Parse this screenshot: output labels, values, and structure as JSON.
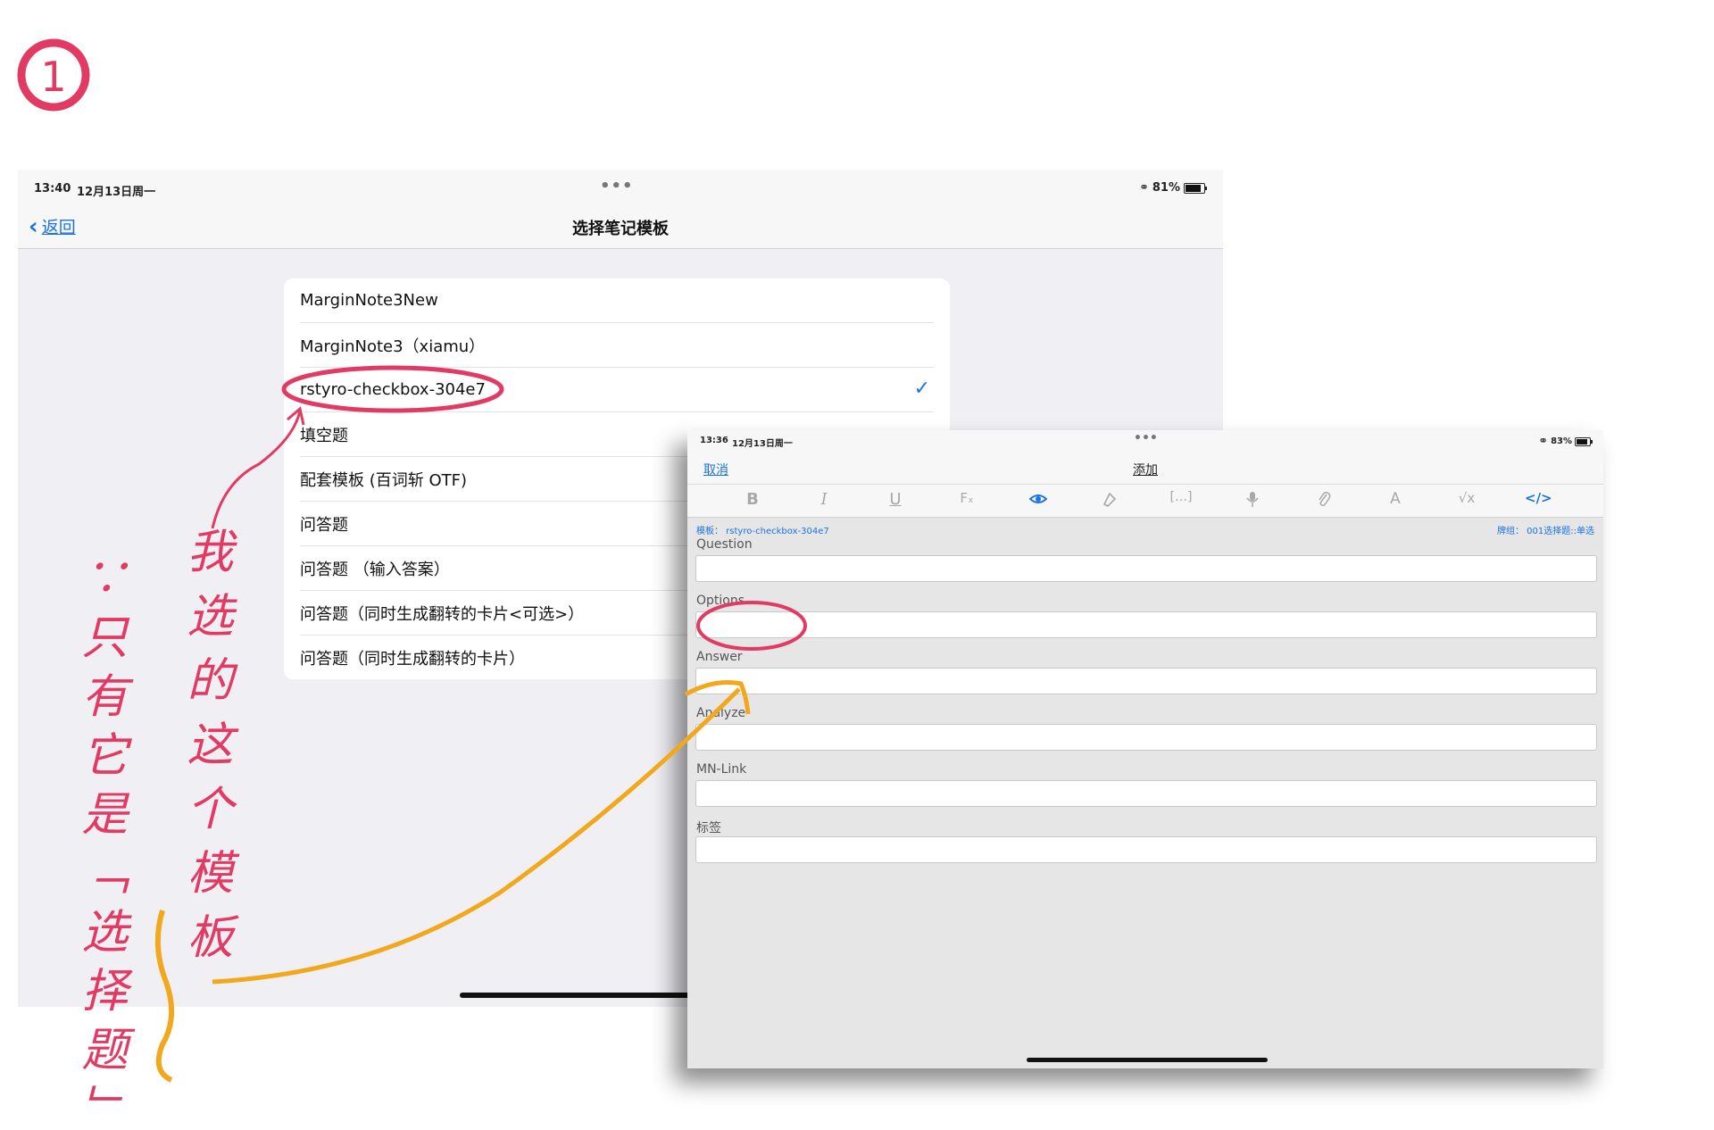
{
  "step_marker": "1",
  "screen1": {
    "status": {
      "time": "13:40",
      "date": "12月13日周一",
      "battery": "81%"
    },
    "nav": {
      "back_label": "返回",
      "title": "选择笔记模板"
    },
    "templates": [
      {
        "label": "MarginNote3New",
        "selected": false
      },
      {
        "label": "MarginNote3（xiamu）",
        "selected": false
      },
      {
        "label": "rstyro-checkbox-304e7",
        "selected": true
      },
      {
        "label": "填空题",
        "selected": false
      },
      {
        "label": "配套模板 (百词斩 OTF)",
        "selected": false
      },
      {
        "label": "问答题",
        "selected": false
      },
      {
        "label": "问答题 （输入答案）",
        "selected": false
      },
      {
        "label": "问答题（同时生成翻转的卡片<可选>）",
        "selected": false
      },
      {
        "label": "问答题（同时生成翻转的卡片）",
        "selected": false
      }
    ],
    "check_glyph": "✓"
  },
  "screen2": {
    "status": {
      "time": "13:36",
      "date": "12月13日周一",
      "battery": "83%"
    },
    "nav": {
      "cancel_label": "取消",
      "title": "添加"
    },
    "toolbar_icons": [
      "bold-icon",
      "italic-icon",
      "underline-icon",
      "clear-format-icon",
      "eye-icon",
      "highlighter-icon",
      "cloze-icon",
      "microphone-icon",
      "paperclip-icon",
      "text-style-icon",
      "formula-icon",
      "code-icon"
    ],
    "meta": {
      "template": "模板： rstyro-checkbox-304e7",
      "deck": "牌组： 001选择题::单选"
    },
    "fields": [
      "Question",
      "Options",
      "Answer",
      "Analyze",
      "MN-Link",
      "标签"
    ]
  },
  "annotations": {
    "left_note": "∵只有它是「选择题」",
    "right_note": "我选的这个模板",
    "colors": {
      "pink": "#e23b63",
      "orange": "#f2a81d"
    }
  }
}
